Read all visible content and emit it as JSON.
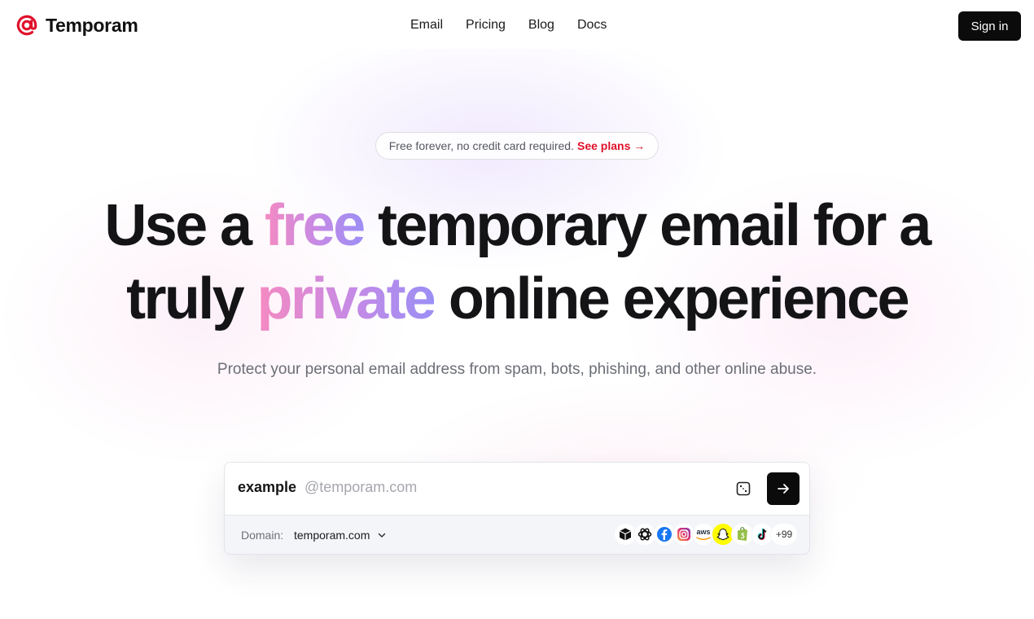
{
  "header": {
    "brand": "Temporam",
    "nav": [
      {
        "label": "Email"
      },
      {
        "label": "Pricing"
      },
      {
        "label": "Blog"
      },
      {
        "label": "Docs"
      }
    ],
    "sign_in": "Sign in"
  },
  "badge": {
    "text": "Free forever, no credit card required.",
    "link": "See plans →"
  },
  "hero": {
    "line1_pre": "Use a ",
    "line1_accent": "free",
    "line1_post": " temporary email for a",
    "line2_pre": "truly ",
    "line2_accent": "private",
    "line2_post": " online experience",
    "subtitle": "Protect your personal email address from spam, bots, phishing, and other online abuse."
  },
  "email_box": {
    "username": "example",
    "domain_suffix": "@temporam.com",
    "domain_label": "Domain:",
    "domain_value": "temporam.com",
    "brands": [
      "box-icon",
      "openai-icon",
      "facebook-icon",
      "instagram-icon",
      "aws-icon",
      "snapchat-icon",
      "shopify-icon",
      "tiktok-icon"
    ],
    "brand_aws_text": "aws",
    "more_count": "+99"
  },
  "colors": {
    "brand_red": "#e0112b",
    "accent_pink": "#f58ac2",
    "accent_purple": "#9b8ff5",
    "button_dark": "#0b0b0b"
  }
}
